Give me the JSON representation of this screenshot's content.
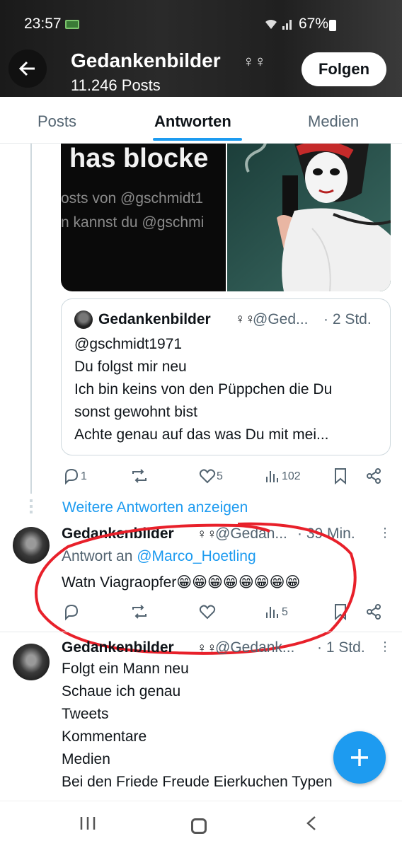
{
  "status_bar": {
    "time": "23:57",
    "battery": "67%"
  },
  "header": {
    "back_icon": "arrow-left-icon",
    "name": "Gedankenbilder",
    "badge": "♀♀",
    "posts_count": "11.246 Posts",
    "follow_label": "Folgen"
  },
  "tabs": [
    {
      "label": "Posts",
      "active": false
    },
    {
      "label": "Antworten",
      "active": true
    },
    {
      "label": "Medien",
      "active": false
    }
  ],
  "media": {
    "left_big_text": "has blocke",
    "left_line1": "osts von @gschmidt1",
    "left_line2": "n kannst du @gschmi"
  },
  "quoted_tweet": {
    "name": "Gedankenbilder",
    "badge": "♀♀",
    "handle": "@Ged...",
    "time": "· 2 Std.",
    "lines": [
      "@gschmidt1971",
      "Du folgst mir neu",
      "Ich bin keins von den Püppchen die Du",
      "sonst gewohnt bist",
      "Achte genau auf das was Du mit mei..."
    ]
  },
  "tweet1_actions": {
    "replies": "1",
    "likes": "5",
    "views": "102"
  },
  "more_replies": "Weitere Antworten anzeigen",
  "tweet2": {
    "name": "Gedankenbilder",
    "badge": "♀♀",
    "handle": "@Gedan...",
    "time": "· 39 Min.",
    "reply_prefix": "Antwort an",
    "reply_mention": "@Marco_Hoetling",
    "text": "Watn Viagraopfer😁😁😁😁😁😁😁😁",
    "views": "5"
  },
  "tweet3": {
    "name": "Gedankenbilder",
    "badge": "♀♀",
    "handle": "@Gedank...",
    "time": "· 1 Std.",
    "lines": [
      "Folgt ein Mann neu",
      "Schaue ich genau",
      "Tweets",
      "Kommentare",
      "Medien",
      "Bei den Friede Freude Eierkuchen Typen"
    ]
  },
  "fab_icon": "plus-icon",
  "nav": {
    "recents_icon": "recents-icon",
    "home_icon": "home-icon",
    "back_icon": "back-chevron-icon"
  },
  "colors": {
    "accent": "#1d9bf0",
    "annotation": "#e8202a",
    "text": "#0f1419",
    "muted": "#536471"
  }
}
